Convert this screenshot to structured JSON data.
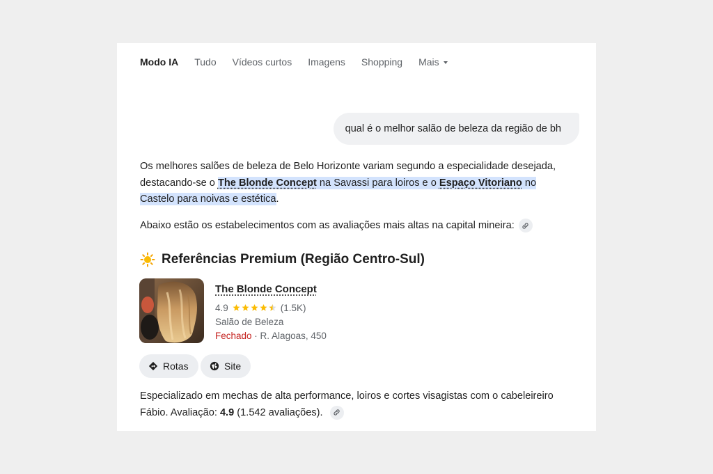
{
  "nav": {
    "tabs": [
      {
        "label": "Modo IA",
        "active": true
      },
      {
        "label": "Tudo"
      },
      {
        "label": "Vídeos curtos"
      },
      {
        "label": "Imagens"
      },
      {
        "label": "Shopping"
      },
      {
        "label": "Mais"
      }
    ]
  },
  "query": "qual é o melhor salão de beleza da região de bh",
  "answer": {
    "p1_a": "Os melhores salões de beleza de Belo Horizonte variam segundo a especialidade desejada, destacando-se o ",
    "p1_link1": "The Blonde Concept",
    "p1_b": " na Savassi para loiros e o ",
    "p1_link2": "Espaço Vitoriano",
    "p1_c": " no Castelo para noivas e estética",
    "p1_end": ".",
    "p2": "Abaixo estão os estabelecimentos com as avaliações mais altas na capital mineira:"
  },
  "section": {
    "icon": "sun-icon",
    "title": "Referências Premium (Região Centro-Sul)"
  },
  "place": {
    "name": "The Blonde Concept",
    "rating": "4.9",
    "rating_value": 4.9,
    "reviews": "(1.5K)",
    "category": "Salão de Beleza",
    "status": "Fechado",
    "separator": " · ",
    "address": "R. Alagoas, 450"
  },
  "actions": {
    "directions_label": "Rotas",
    "site_label": "Site"
  },
  "description": {
    "text_a": "Especializado em mechas de alta performance, loiros e cortes visagistas com o cabeleireiro Fábio. Avaliação: ",
    "rating": "4.9",
    "text_b": " (1.542 avaliações)."
  },
  "colors": {
    "highlight": "#d3e3fd",
    "closed": "#c5221f",
    "star": "#fbbc04",
    "chip_bg": "#eceef1"
  }
}
